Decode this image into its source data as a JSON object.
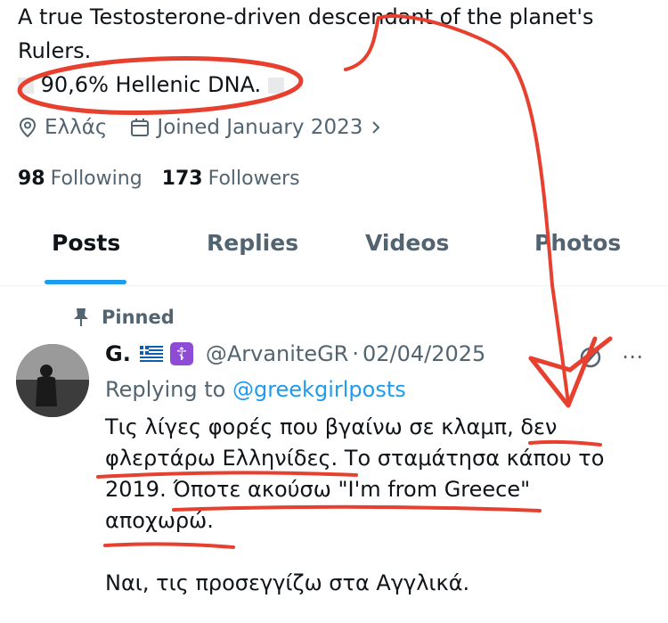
{
  "profile": {
    "bio_line1": "A true Testosterone-driven descendant of the planet's",
    "bio_line2": "Rulers.",
    "bio_line3": "90,6% Hellenic DNA.",
    "location": "Ελλάς",
    "joined": "Joined January 2023",
    "following_count": "98",
    "following_label": "Following",
    "followers_count": "173",
    "followers_label": "Followers"
  },
  "tabs": [
    {
      "label": "Posts",
      "active": true
    },
    {
      "label": "Replies",
      "active": false
    },
    {
      "label": "Videos",
      "active": false
    },
    {
      "label": "Photos",
      "active": false
    }
  ],
  "tweet": {
    "pinned_label": "Pinned",
    "name": "G.",
    "handle": "@ArvaniteGR",
    "separator": "·",
    "date": "02/04/2025",
    "replying_prefix": "Replying to",
    "replying_handle": "@greekgirlposts",
    "body_lines": [
      "Τις λίγες φορές που βγαίνω σε κλαμπ, δεν",
      "φλερτάρω Ελληνίδες. Το σταμάτησα κάπου το",
      "2019. Όποτε ακούσω \"I'm from Greece\"",
      "αποχωρώ."
    ],
    "body_last": "Ναι, τις προσεγγίζω στα Αγγλικά.",
    "more_icon": "⋯"
  },
  "colors": {
    "accent": "#1d9bf0",
    "text": "#0f1419",
    "muted": "#536471",
    "annotation": "#e8402f"
  }
}
